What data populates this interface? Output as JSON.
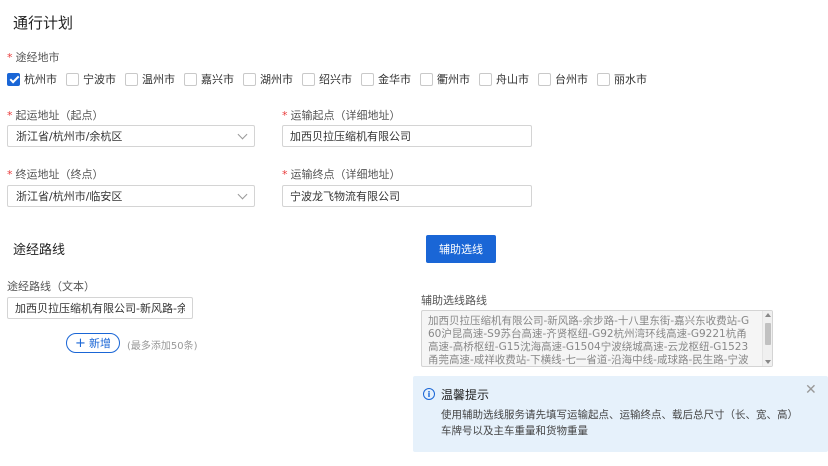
{
  "page": {
    "title": "通行计划"
  },
  "route_cities": {
    "label": "途经地市",
    "options": [
      {
        "label": "杭州市",
        "checked": true
      },
      {
        "label": "宁波市",
        "checked": false
      },
      {
        "label": "温州市",
        "checked": false
      },
      {
        "label": "嘉兴市",
        "checked": false
      },
      {
        "label": "湖州市",
        "checked": false
      },
      {
        "label": "绍兴市",
        "checked": false
      },
      {
        "label": "金华市",
        "checked": false
      },
      {
        "label": "衢州市",
        "checked": false
      },
      {
        "label": "舟山市",
        "checked": false
      },
      {
        "label": "台州市",
        "checked": false
      },
      {
        "label": "丽水市",
        "checked": false
      }
    ]
  },
  "origin": {
    "region_label": "起运地址（起点）",
    "region_value": "浙江省/杭州市/余杭区",
    "detail_label": "运输起点（详细地址）",
    "detail_value": "加西贝拉压缩机有限公司"
  },
  "destination": {
    "region_label": "终运地址（终点）",
    "region_value": "浙江省/杭州市/临安区",
    "detail_label": "运输终点（详细地址）",
    "detail_value": "宁波龙飞物流有限公司"
  },
  "route": {
    "section_title": "途经路线",
    "text_label": "途经路线（文本）",
    "text_value": "加西贝拉压缩机有限公司-新风路-余杭",
    "add_button": "新增",
    "add_hint": "(最多添加50条)"
  },
  "assist": {
    "button_label": "辅助选线",
    "field_label": "辅助选线路线",
    "field_value": "加西贝拉压缩机有限公司-新风路-余步路-十八里东街-嘉兴东收费站-G60沪昆高速-S9苏台高速-齐贤枢纽-G92杭州湾环线高速-G9221杭甬高速-高桥枢纽-G15沈海高速-G1504宁波绕城高速-云龙枢纽-G1523甬莞高速-咸祥收费站-下横线-七一省道-沿海中线-咸球路-民生路-宁波龙飞物流有限公司"
  },
  "notice": {
    "title": "温馨提示",
    "body": "使用辅助选线服务请先填写运输起点、运输终点、载后总尺寸（长、宽、高）车牌号以及主车重量和货物重量"
  },
  "colors": {
    "accent": "#1a66d6",
    "required": "#e83a3a",
    "notice_bg": "#e6f1fb"
  }
}
